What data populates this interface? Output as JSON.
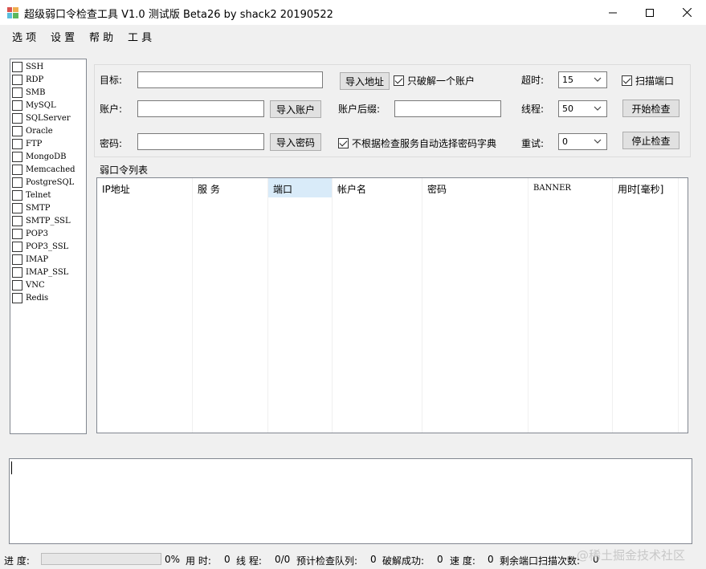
{
  "window": {
    "title": "超级弱口令检查工具 V1.0 测试版 Beta26 by shack2 20190522",
    "minimize_label": "─",
    "maximize_label": "□",
    "close_label": "✕"
  },
  "menu": [
    "选 项",
    "设 置",
    "帮 助",
    "工 具"
  ],
  "services": [
    {
      "name": "SSH",
      "checked": false
    },
    {
      "name": "RDP",
      "checked": false
    },
    {
      "name": "SMB",
      "checked": false
    },
    {
      "name": "MySQL",
      "checked": false
    },
    {
      "name": "SQLServer",
      "checked": false
    },
    {
      "name": "Oracle",
      "checked": false
    },
    {
      "name": "FTP",
      "checked": false
    },
    {
      "name": "MongoDB",
      "checked": false
    },
    {
      "name": "Memcached",
      "checked": false
    },
    {
      "name": "PostgreSQL",
      "checked": false
    },
    {
      "name": "Telnet",
      "checked": false
    },
    {
      "name": "SMTP",
      "checked": false
    },
    {
      "name": "SMTP_SSL",
      "checked": false
    },
    {
      "name": "POP3",
      "checked": false
    },
    {
      "name": "POP3_SSL",
      "checked": false
    },
    {
      "name": "IMAP",
      "checked": false
    },
    {
      "name": "IMAP_SSL",
      "checked": false
    },
    {
      "name": "VNC",
      "checked": false
    },
    {
      "name": "Redis",
      "checked": false
    }
  ],
  "settings": {
    "target_label": "目标:",
    "target_value": "",
    "import_target_button": "导入地址",
    "only_crack_one_label": "只破解一个账户",
    "only_crack_one_checked": true,
    "timeout_label": "超时:",
    "timeout_value": "15",
    "scan_port_label": "扫描端口",
    "scan_port_checked": true,
    "account_label": "账户:",
    "account_value": "",
    "import_account_button": "导入账户",
    "account_suffix_label": "账户后缀:",
    "account_suffix_value": "",
    "threads_label": "线程:",
    "threads_value": "50",
    "start_button": "开始检查",
    "password_label": "密码:",
    "password_value": "",
    "import_password_button": "导入密码",
    "auto_dict_label": "不根据检查服务自动选择密码字典",
    "auto_dict_checked": true,
    "retry_label": "重试:",
    "retry_value": "0",
    "stop_button": "停止检查"
  },
  "result_list": {
    "group_label": "弱口令列表",
    "columns": [
      "IP地址",
      "服 务",
      "端口",
      "帐户名",
      "密码",
      "BANNER",
      "用时[毫秒]"
    ],
    "rows": []
  },
  "log": {
    "text": ""
  },
  "status": {
    "progress_label": "进 度:",
    "progress_fraction": 0,
    "progress_text": "0%",
    "time_label": "用 时:",
    "time_value": "0",
    "threads_label": "线 程:",
    "threads_value": "0/0",
    "queue_label": "预计检查队列:",
    "queue_value": "0",
    "success_label": "破解成功:",
    "success_value": "0",
    "speed_label": "速 度:",
    "speed_value": "0",
    "remaining_label": "剩余端口扫描次数:",
    "remaining_value": "0"
  },
  "watermark": "@稀土掘金技术社区"
}
